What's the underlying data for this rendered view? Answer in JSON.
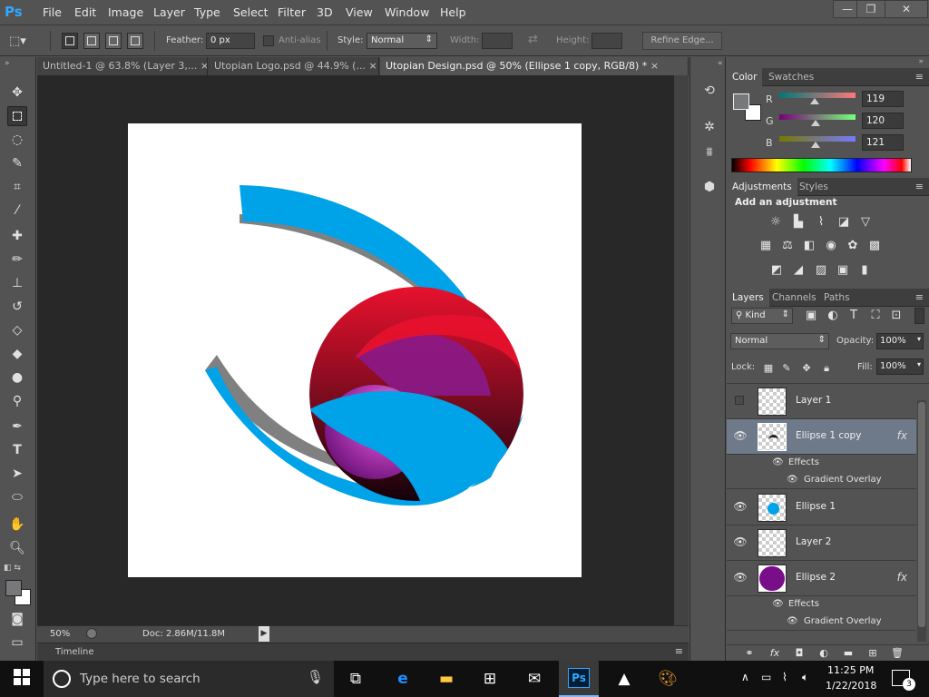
{
  "menubar": {
    "logo": "Ps",
    "items": [
      "File",
      "Edit",
      "Image",
      "Layer",
      "Type",
      "Select",
      "Filter",
      "3D",
      "View",
      "Window",
      "Help"
    ],
    "win_minimize": "—",
    "win_restore": "❐",
    "win_close": "✕"
  },
  "options": {
    "feather_label": "Feather:",
    "feather_value": "0 px",
    "antialias_label": "Anti-alias",
    "style_label": "Style:",
    "style_value": "Normal",
    "width_label": "Width:",
    "height_label": "Height:",
    "refine_label": "Refine Edge..."
  },
  "tabs": [
    {
      "label": "Untitled-1 @ 63.8% (Layer 3,...",
      "close": "×"
    },
    {
      "label": "Utopian Logo.psd @ 44.9% (...",
      "close": "×"
    },
    {
      "label": "Utopian Design.psd @ 50% (Ellipse 1 copy, RGB/8) *",
      "close": "×"
    }
  ],
  "status": {
    "zoom": "50%",
    "doc": "Doc: 2.86M/11.8M"
  },
  "timeline": {
    "label": "Timeline"
  },
  "color_panel": {
    "tabs": [
      "Color",
      "Swatches"
    ],
    "r_label": "R",
    "r_value": "119",
    "r_fraction": 0.467,
    "g_label": "G",
    "g_value": "120",
    "g_fraction": 0.471,
    "b_label": "B",
    "b_value": "121",
    "b_fraction": 0.475,
    "foreground": "#777879"
  },
  "adjustments_panel": {
    "tabs": [
      "Adjustments",
      "Styles"
    ],
    "heading": "Add an adjustment"
  },
  "layers_panel": {
    "tabs": [
      "Layers",
      "Channels",
      "Paths"
    ],
    "kind_label": "Kind",
    "blend_mode": "Normal",
    "opacity_label": "Opacity:",
    "opacity_value": "100%",
    "lock_label": "Lock:",
    "fill_label": "Fill:",
    "fill_value": "100%",
    "layers": [
      {
        "name": "Layer 1",
        "visible": false,
        "fx": ""
      },
      {
        "name": "Ellipse 1 copy",
        "visible": true,
        "fx": "fx",
        "effects": "Effects",
        "effect_item": "Gradient Overlay"
      },
      {
        "name": "Ellipse 1",
        "visible": true,
        "fx": ""
      },
      {
        "name": "Layer 2",
        "visible": true,
        "fx": ""
      },
      {
        "name": "Ellipse 2",
        "visible": true,
        "fx": "fx",
        "effects": "Effects",
        "effect_item": "Gradient Overlay"
      }
    ]
  },
  "taskbar": {
    "search_placeholder": "Type here to search",
    "time": "11:25 PM",
    "date": "1/22/2018",
    "notification_count": "3"
  },
  "colors": {
    "accent": "#31a8ff",
    "canvas_blue": "#00a2e8",
    "canvas_gray": "#808080",
    "canvas_red": "#e0112b",
    "canvas_purple": "#a020a0"
  }
}
